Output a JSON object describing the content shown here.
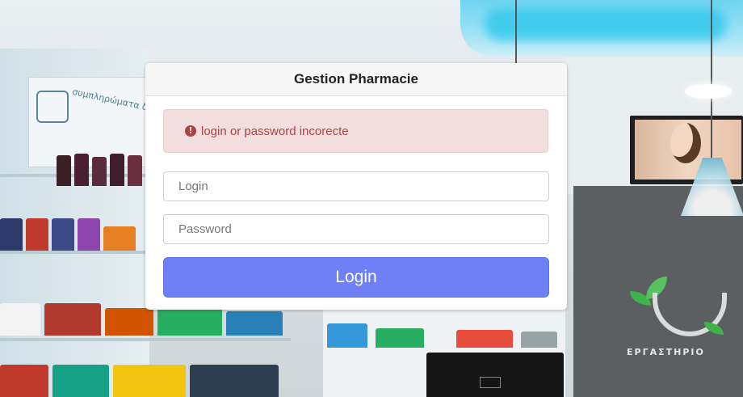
{
  "app": {
    "title": "Gestion Pharmacie"
  },
  "alert": {
    "icon": "exclamation-circle-icon",
    "message": "login or password incorecte",
    "color": "#a94442",
    "background": "#f2dede"
  },
  "form": {
    "login_placeholder": "Login",
    "login_value": "",
    "password_placeholder": "Password",
    "password_value": "",
    "submit_label": "Login",
    "submit_color": "#6f7ff5"
  },
  "background": {
    "shelf_sign_text": "συμπληρώματα διατροφής",
    "store_logo_text": "ΕΡΓΑΣΤΗΡΙΟ"
  }
}
